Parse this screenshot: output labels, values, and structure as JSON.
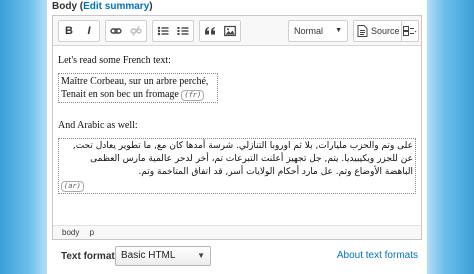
{
  "field": {
    "label": "Body",
    "summary_open": "(",
    "summary_link": "Edit summary",
    "summary_close": ")"
  },
  "toolbar": {
    "bold_label": "B",
    "italic_label": "I",
    "format_value": "Normal",
    "source_label": "Source"
  },
  "content": {
    "intro": "Let's read some French text:",
    "french_lines": [
      "Maître Corbeau, sur un arbre perché,",
      "Tenait en son bec un fromage"
    ],
    "french_tag": "(fr)",
    "arabic_intro": "And Arabic as well:",
    "arabic_text": "على وتم والحزب مليارات, بلا ثم اوروبا التنازلي. شرسة أمدها كان مع, ما تطوير يعادل تحت, عن للجزر ويكيبيديا. يتم, جل تجهيز أعلنت التبرعات تم، أخر لدحر عالمية مارس العظمى الباهضة الأوضاع وتم. عل مارد أحكام الولايات أسر, قد اتفاق المتاخمة وتم.",
    "arabic_tag": "(ar)"
  },
  "statusbar": {
    "path": [
      "body",
      "p"
    ]
  },
  "footer": {
    "text_format_label": "Text format",
    "text_format_value": "Basic HTML",
    "about_link": "About text formats"
  },
  "colors": {
    "link": "#0074bd",
    "background": "#3a9fd8"
  }
}
